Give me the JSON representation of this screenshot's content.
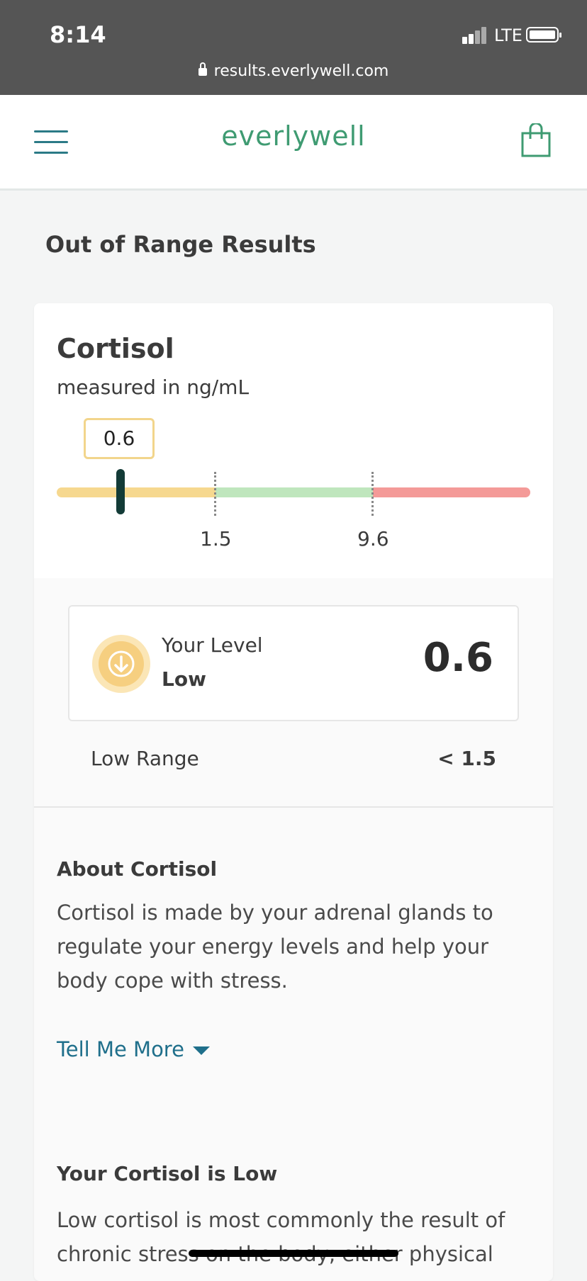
{
  "status_bar": {
    "time": "8:14",
    "network": "LTE",
    "url": "results.everlywell.com"
  },
  "header": {
    "logo": "everlywell",
    "menu_icon": "hamburger-menu-icon",
    "cart_icon": "shopping-bag-icon"
  },
  "page": {
    "section_title": "Out of Range Results"
  },
  "marker": {
    "name": "Cortisol",
    "units": "measured in ng/mL",
    "value_tag": "0.6",
    "tick_low": "1.5",
    "tick_high": "9.6",
    "colors": {
      "low": "#f6d88f",
      "normal": "#bfe6bd",
      "high": "#f49a98",
      "needle": "#133b37"
    }
  },
  "level": {
    "caption": "Your Level",
    "status": "Low",
    "value": "0.6",
    "icon": "arrow-down-circle-icon"
  },
  "range": {
    "label": "Low Range",
    "value": "< 1.5"
  },
  "about": {
    "title": "About Cortisol",
    "text": "Cortisol is made by your adrenal glands to regulate your energy levels and help your body cope with stress.",
    "tell_more": "Tell Me More"
  },
  "low_section": {
    "title": "Your Cortisol is Low",
    "text": "Low cortisol is most commonly the result of chronic stress on the body, either physical"
  }
}
